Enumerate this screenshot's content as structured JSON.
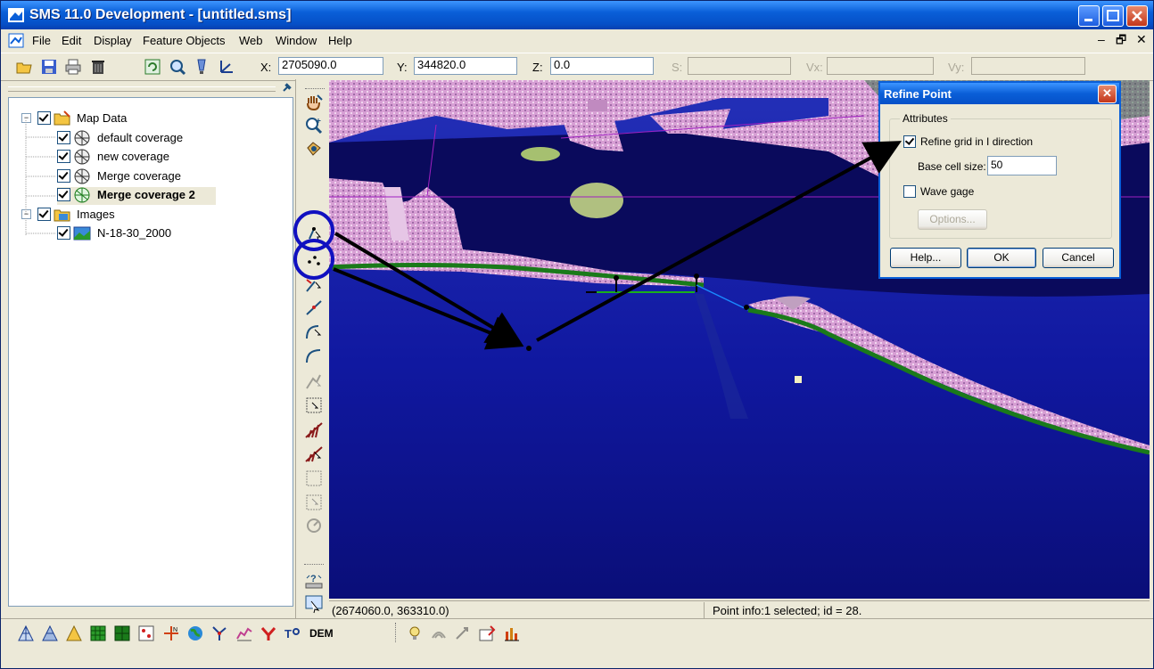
{
  "window": {
    "title": "SMS 11.0 Development - [untitled.sms]"
  },
  "menu": [
    "File",
    "Edit",
    "Display",
    "Feature Objects",
    "Web",
    "Window",
    "Help"
  ],
  "coords": {
    "x_label": "X:",
    "x_value": "2705090.0",
    "y_label": "Y:",
    "y_value": "344820.0",
    "z_label": "Z:",
    "z_value": "0.0",
    "s_label": "S:",
    "vx_label": "Vx:",
    "vy_label": "Vy:"
  },
  "tree": {
    "root": "Map Data",
    "coverages": [
      "default coverage",
      "new coverage",
      "Merge coverage",
      "Merge coverage 2"
    ],
    "images_label": "Images",
    "image": "N-18-30_2000"
  },
  "status": {
    "cursor": "(2674060.0, 363310.0)",
    "info": "Point info:1 selected; id = 28."
  },
  "dialog": {
    "title": "Refine Point",
    "group": "Attributes",
    "refine_label": "Refine grid in I direction",
    "refine_checked": true,
    "cell_size_label": "Base cell size:",
    "cell_size_value": "50",
    "wave_gage_label": "Wave gage",
    "options_label": "Options...",
    "help_label": "Help...",
    "ok_label": "OK",
    "cancel_label": "Cancel"
  },
  "bottom_text": "DEM",
  "colors": {
    "title_blue": "#0a5fd8",
    "water": "#0c0e6a",
    "land": "#d9a2d6",
    "shoreline": "#1a7a1a",
    "annotation": "#1010c0"
  }
}
